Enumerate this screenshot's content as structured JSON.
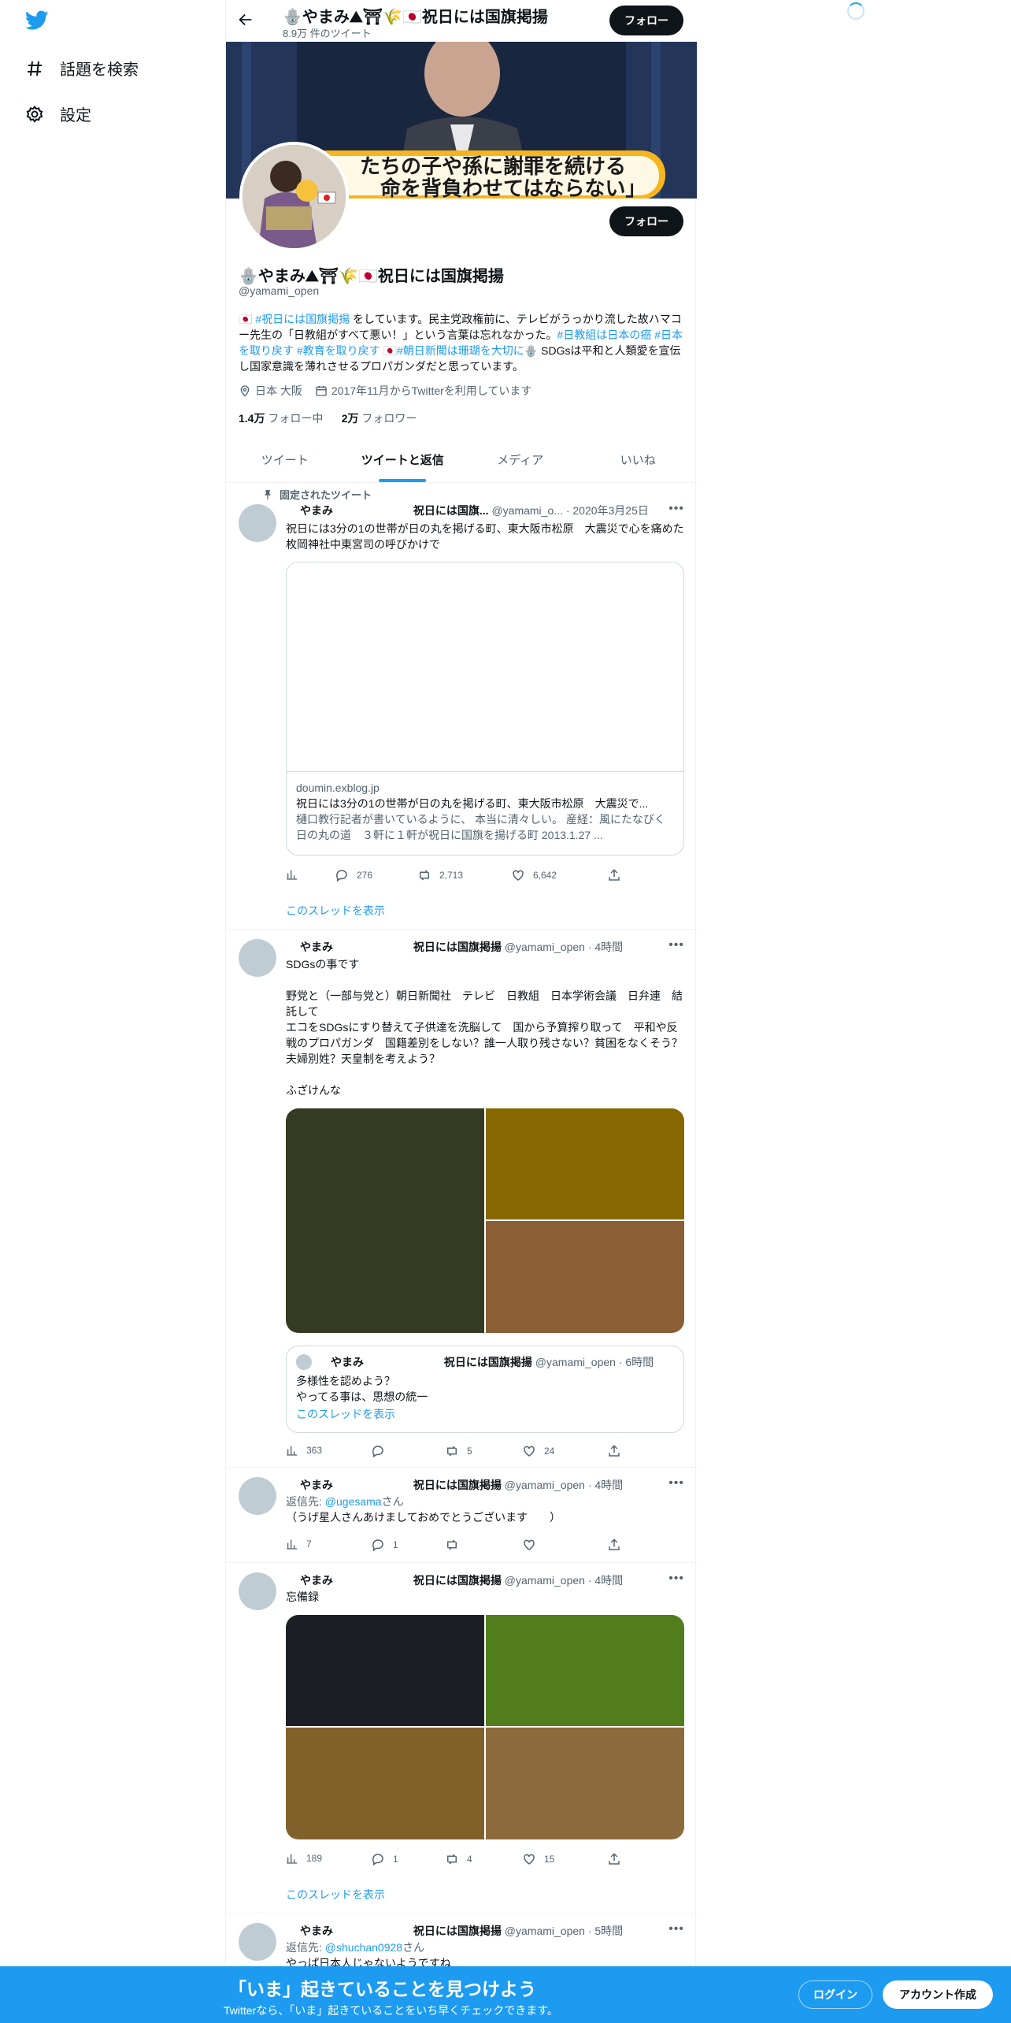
{
  "colors": {
    "accent": "#1d9bf0",
    "text": "#0f1419",
    "secondary": "#536471",
    "footer": "#1d9bf0"
  },
  "nav": {
    "logo": "twitter-bird",
    "items": [
      {
        "label": "話題を検索",
        "icon": "hashtag-icon"
      },
      {
        "label": "設定",
        "icon": "gear-icon"
      }
    ]
  },
  "header": {
    "title": "🪬やまみ⛰⛩🌾🇯🇵祝日には国旗掲揚",
    "tweet_count": "8.9万 件のツイート",
    "follow_label": "フォロー"
  },
  "profile": {
    "banner_caption_line1": "たちの子や孫に謝罪を続ける",
    "banner_caption_line2": "命を背負わせてはならない」",
    "follow_label": "フォロー",
    "name": "🪬やまみ⛰⛩🌾🇯🇵祝日には国旗掲揚",
    "handle": "@yamami_open",
    "bio_parts": {
      "p1": "🇯🇵 ",
      "tag1": "#祝日には国旗掲揚",
      "p2": " をしています。民主党政権前に、テレビがうっかり流した故ハマコー先生の「日教組がすべて悪い！」という言葉は忘れなかった。",
      "tag2": "#日教組は日本の癌",
      "tag3": "#日本を取り戻す",
      "tag4": "#教育を取り戻す",
      "p3": "🇯🇵",
      "tag5": "#朝日新聞は珊瑚を大切に",
      "p4": "🪬 SDGsは平和と人類愛を宣伝し国家意識を薄れさせるプロパガンダだと思っています。"
    },
    "location": "日本 大阪",
    "joined": "2017年11月からTwitterを利用しています",
    "following_count": "1.4万",
    "following_label": "フォロー中",
    "followers_count": "2万",
    "followers_label": "フォロワー"
  },
  "tabs": [
    "ツイート",
    "ツイートと返信",
    "メディア",
    "いいね"
  ],
  "tweets": [
    {
      "pinned_label": "固定されたツイート",
      "name_a": "やまみ",
      "name_b": "祝日には国旗...",
      "handle": "@yamami_o...",
      "date": "2020年3月25日",
      "text": "祝日には3分の1の世帯が日の丸を掲げる町、東大阪市松原　大震災で心を痛めた枚岡神社中東宮司の呼びかけで",
      "card_domain": "doumin.exblog.jp",
      "card_title": "祝日には3分の1の世帯が日の丸を掲げる町、東大阪市松原　大震災で...",
      "card_desc": "樋口教行記者が書いているように、 本当に清々しい。 産経：風にたなびく日の丸の道　３軒に１軒が祝日に国旗を揚げる町 2013.1.27 ...",
      "views": "",
      "replies": "276",
      "retweets": "2,713",
      "likes": "6,642",
      "show_thread": "このスレッドを表示"
    },
    {
      "name_a": "やまみ",
      "name_b": "祝日には国旗掲揚",
      "handle": "@yamami_open",
      "date": "4時間",
      "text": "SDGsの事です\n\n野党と（一部与党と）朝日新聞社　テレビ　日教組　日本学術会議　日弁連　結託して\nエコをSDGsにすり替えて子供達を洗脳して　国から予算搾り取って　平和や反戦のプロパガンダ　国籍差別をしない？誰一人取り残さない？貧困をなくそう？夫婦別姓？天皇制を考えよう？\n\nふざけんな",
      "image_colors": [
        "#353a22",
        "#866700",
        "#8b5e35"
      ],
      "quote_name_a": "やまみ",
      "quote_name_b": "祝日には国旗掲揚",
      "quote_handle": "@yamami_open",
      "quote_date": "6時間",
      "quote_text": "多様性を認めよう？\nやってる事は、思想の統一",
      "quote_show_thread": "このスレッドを表示",
      "views": "363",
      "replies": "",
      "retweets": "5",
      "likes": "24"
    },
    {
      "name_a": "やまみ",
      "name_b": "祝日には国旗掲揚",
      "handle": "@yamami_open",
      "date": "4時間",
      "reply_prefix": "返信先: ",
      "reply_to": "@ugesama",
      "reply_suffix": "さん",
      "text": "（うげ星人さんあけましておめでとうございます　　）",
      "views": "7",
      "replies": "1",
      "retweets": "",
      "likes": ""
    },
    {
      "name_a": "やまみ",
      "name_b": "祝日には国旗掲揚",
      "handle": "@yamami_open",
      "date": "4時間",
      "text": "忘備録",
      "image_colors": [
        "#1c1f26",
        "#527d1d",
        "#81612a",
        "#8b6a3c"
      ],
      "views": "189",
      "replies": "1",
      "retweets": "4",
      "likes": "15",
      "show_thread": "このスレッドを表示"
    },
    {
      "name_a": "やまみ",
      "name_b": "祝日には国旗掲揚",
      "handle": "@yamami_open",
      "date": "5時間",
      "reply_prefix": "返信先: ",
      "reply_to": "@shuchan0928",
      "reply_suffix": "さん",
      "text": "やっぱ日本人じゃないようですね"
    }
  ],
  "footer": {
    "headline": "「いま」起きていることを見つけよう",
    "sub": "Twitterなら、「いま」起きていることをいち早くチェックできます。",
    "login": "ログイン",
    "signup": "アカウント作成"
  }
}
